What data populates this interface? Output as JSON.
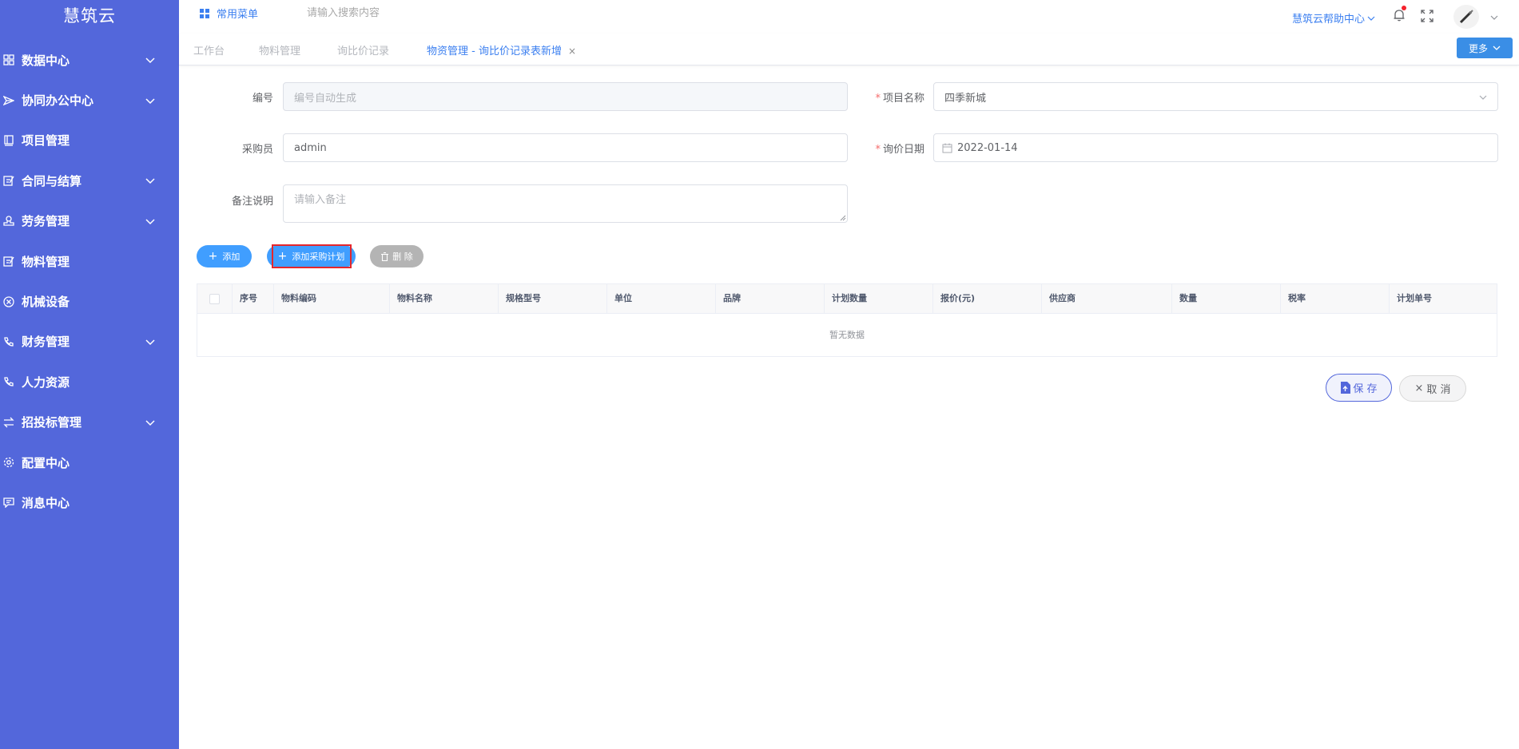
{
  "app": {
    "logo_text": "慧筑云"
  },
  "sidebar": {
    "items": [
      {
        "label": "数据中心",
        "icon": "grid-icon",
        "has_arrow": true
      },
      {
        "label": "协同办公中心",
        "icon": "send-icon",
        "has_arrow": true
      },
      {
        "label": "项目管理",
        "icon": "book-icon",
        "has_arrow": false
      },
      {
        "label": "合同与结算",
        "icon": "edit-icon",
        "has_arrow": true
      },
      {
        "label": "劳务管理",
        "icon": "stamp-icon",
        "has_arrow": true
      },
      {
        "label": "物料管理",
        "icon": "edit-icon",
        "has_arrow": false
      },
      {
        "label": "机械设备",
        "icon": "close-circle-icon",
        "has_arrow": false
      },
      {
        "label": "财务管理",
        "icon": "phone-icon",
        "has_arrow": true
      },
      {
        "label": "人力资源",
        "icon": "phone-icon",
        "has_arrow": false
      },
      {
        "label": "招投标管理",
        "icon": "swap-icon",
        "has_arrow": true
      },
      {
        "label": "配置中心",
        "icon": "gear-icon",
        "has_arrow": false
      },
      {
        "label": "消息中心",
        "icon": "message-icon",
        "has_arrow": false
      }
    ]
  },
  "header": {
    "common_menu_label": "常用菜单",
    "search_placeholder": "请输入搜索内容",
    "help_center_label": "慧筑云帮助中心"
  },
  "tabs": {
    "items": [
      {
        "label": "工作台",
        "active": false
      },
      {
        "label": "物料管理",
        "active": false
      },
      {
        "label": "询比价记录",
        "active": false
      },
      {
        "label": "物资管理 - 询比价记录表新增",
        "active": true,
        "closable": true
      }
    ],
    "close_glyph": "×",
    "more_label": "更多"
  },
  "form": {
    "code_label": "编号",
    "code_placeholder": "编号自动生成",
    "project_label": "项目名称",
    "project_value": "四季新城",
    "buyer_label": "采购员",
    "buyer_value": "admin",
    "date_label": "询价日期",
    "date_value": "2022-01-14",
    "remark_label": "备注说明",
    "remark_placeholder": "请输入备注",
    "required_mark": "*"
  },
  "toolbar": {
    "add_label": "添加",
    "add_plan_label": "添加采购计划",
    "delete_label": "删 除",
    "plus_glyph": "+"
  },
  "table": {
    "columns": [
      "序号",
      "物料编码",
      "物料名称",
      "规格型号",
      "单位",
      "品牌",
      "计划数量",
      "报价(元)",
      "供应商",
      "数量",
      "税率",
      "计划单号"
    ],
    "empty_text": "暂无数据"
  },
  "actions": {
    "save_label": "保 存",
    "cancel_label": "取 消",
    "cancel_glyph": "×"
  },
  "colors": {
    "sidebar_bg": "#5367db",
    "primary": "#409eff",
    "link": "#3b7ff0",
    "highlight": "#e5262b"
  }
}
